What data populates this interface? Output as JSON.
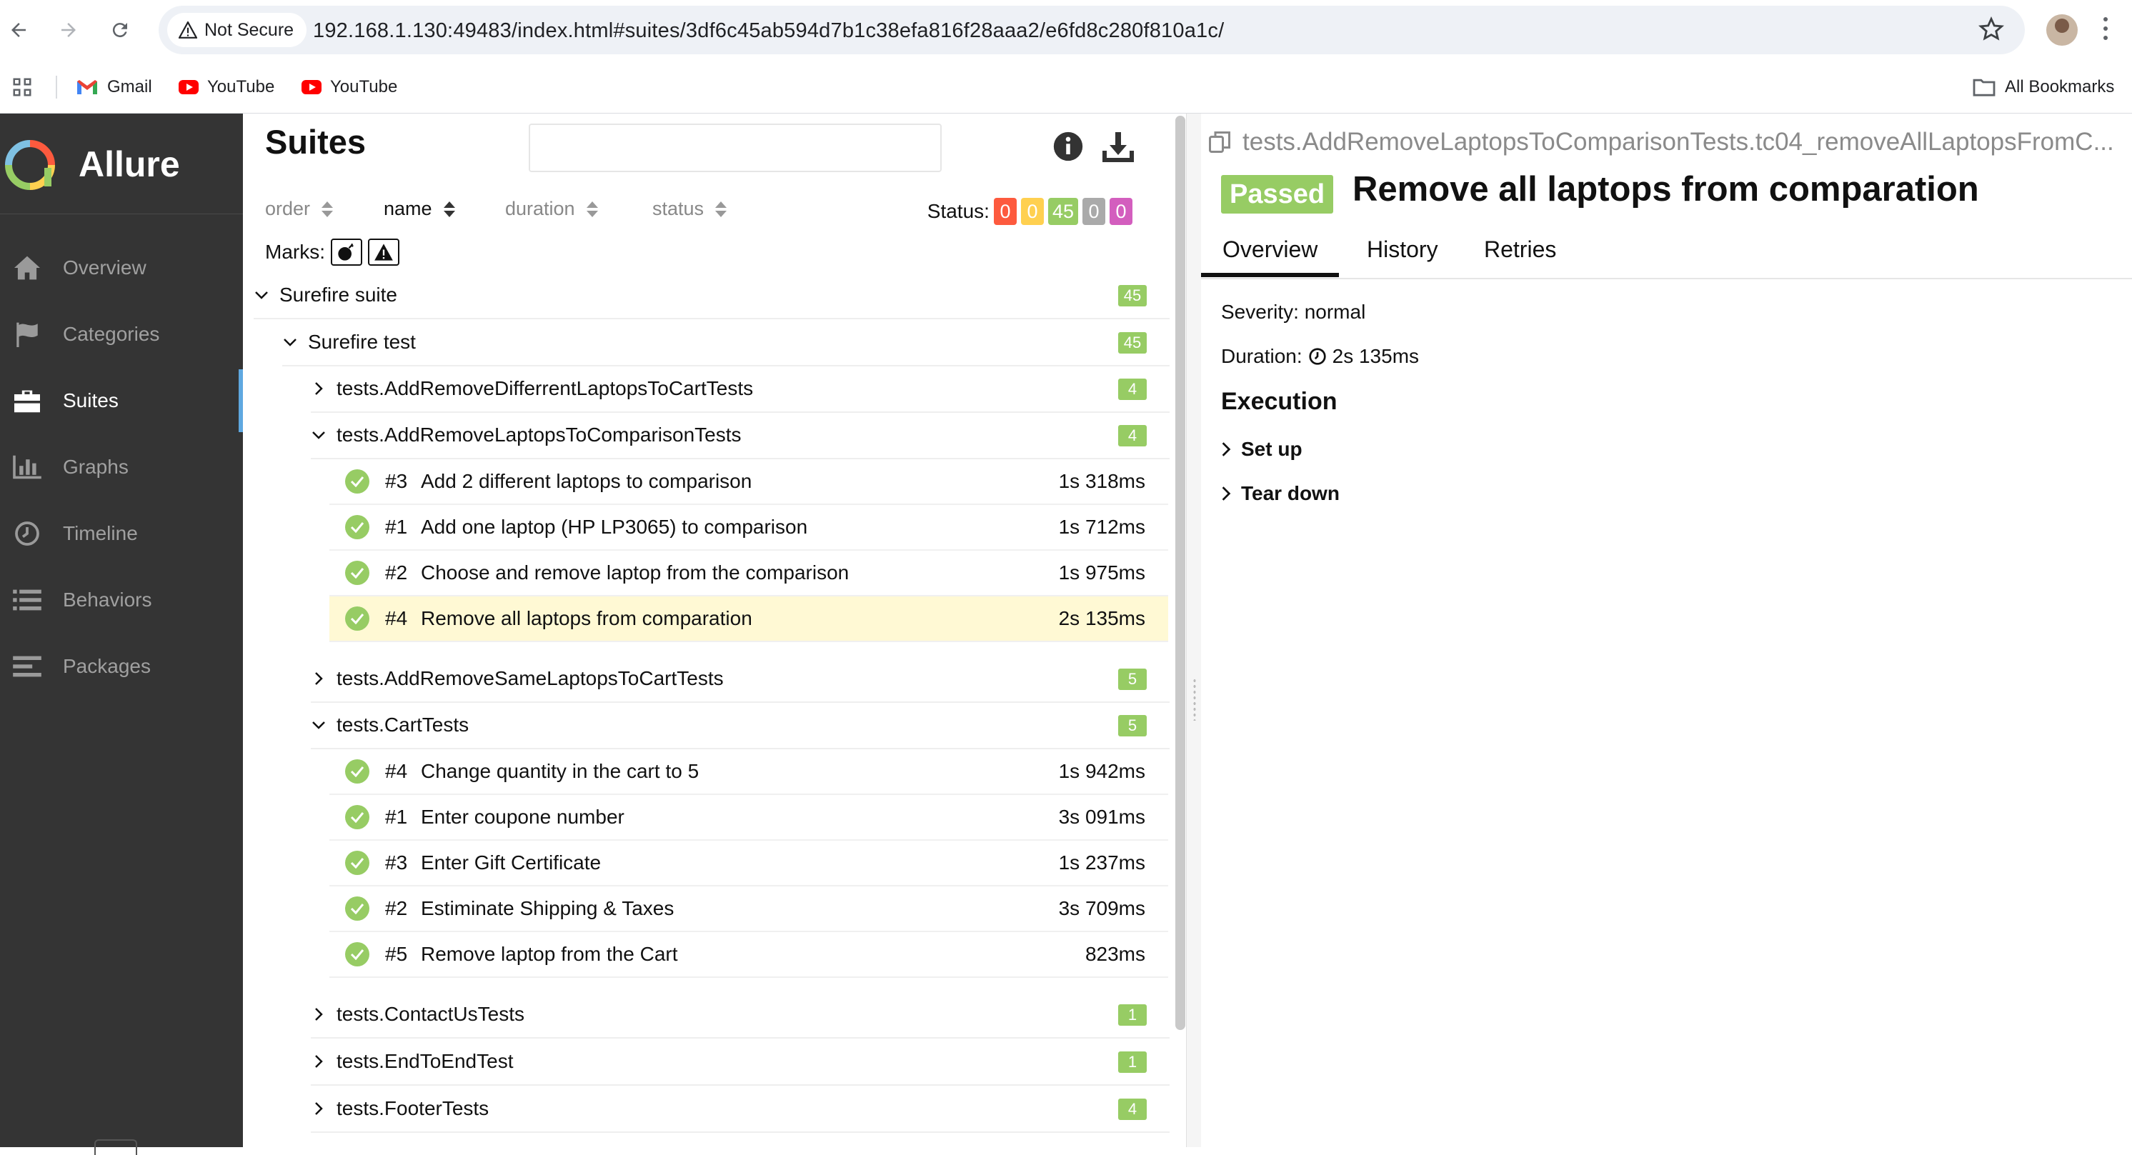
{
  "browser": {
    "security_label": "Not Secure",
    "url": "192.168.1.130:49483/index.html#suites/3df6c45ab594d7b1c38efa816f28aaa2/e6fd8c280f810a1c/",
    "bookmarks": [
      "Gmail",
      "YouTube",
      "YouTube"
    ],
    "all_bookmarks": "All Bookmarks"
  },
  "sidebar": {
    "brand": "Allure",
    "items": [
      {
        "label": "Overview",
        "icon": "home-icon"
      },
      {
        "label": "Categories",
        "icon": "flag-icon"
      },
      {
        "label": "Suites",
        "icon": "briefcase-icon"
      },
      {
        "label": "Graphs",
        "icon": "bar-chart-icon"
      },
      {
        "label": "Timeline",
        "icon": "clock-icon"
      },
      {
        "label": "Behaviors",
        "icon": "list-icon"
      },
      {
        "label": "Packages",
        "icon": "align-left-icon"
      }
    ]
  },
  "suites": {
    "title": "Suites",
    "search_value": "",
    "sort": [
      "order",
      "name",
      "duration",
      "status"
    ],
    "status_label": "Status:",
    "status_counts": [
      {
        "value": "0",
        "color": "#fd5a3e"
      },
      {
        "value": "0",
        "color": "#ffd050"
      },
      {
        "value": "45",
        "color": "#97cc64"
      },
      {
        "value": "0",
        "color": "#aaaaaa"
      },
      {
        "value": "0",
        "color": "#d35ebe"
      }
    ],
    "marks_label": "Marks:",
    "tree": {
      "root": {
        "name": "Surefire suite",
        "count": "45"
      },
      "test": {
        "name": "Surefire test",
        "count": "45"
      },
      "classes": [
        {
          "name": "tests.AddRemoveDifferrentLaptopsToCartTests",
          "count": "4"
        },
        {
          "name": "tests.AddRemoveLaptopsToComparisonTests",
          "count": "4"
        },
        {
          "name": "tests.AddRemoveSameLaptopsToCartTests",
          "count": "5"
        },
        {
          "name": "tests.CartTests",
          "count": "5"
        },
        {
          "name": "tests.ContactUsTests",
          "count": "1"
        },
        {
          "name": "tests.EndToEndTest",
          "count": "1"
        },
        {
          "name": "tests.FooterTests",
          "count": "4"
        }
      ],
      "comparison_tests": [
        {
          "num": "#3",
          "name": "Add 2 different laptops to comparison",
          "duration": "1s 318ms"
        },
        {
          "num": "#1",
          "name": "Add one laptop (HP LP3065) to comparison",
          "duration": "1s 712ms"
        },
        {
          "num": "#2",
          "name": "Choose and remove laptop from the comparison",
          "duration": "1s 975ms"
        },
        {
          "num": "#4",
          "name": "Remove all laptops from comparation",
          "duration": "2s 135ms"
        }
      ],
      "cart_tests": [
        {
          "num": "#4",
          "name": "Change quantity in the cart to 5",
          "duration": "1s 942ms"
        },
        {
          "num": "#1",
          "name": "Enter coupone number",
          "duration": "3s 091ms"
        },
        {
          "num": "#3",
          "name": "Enter Gift Certificate",
          "duration": "1s 237ms"
        },
        {
          "num": "#2",
          "name": "Estiminate Shipping & Taxes",
          "duration": "3s 709ms"
        },
        {
          "num": "#5",
          "name": "Remove laptop from the Cart",
          "duration": "823ms"
        }
      ]
    }
  },
  "detail": {
    "breadcrumb": "tests.AddRemoveLaptopsToComparisonTests.tc04_removeAllLaptopsFromC...",
    "status": "Passed",
    "title": "Remove all laptops from comparation",
    "tabs": [
      "Overview",
      "History",
      "Retries"
    ],
    "severity": "Severity: normal",
    "duration_label": "Duration:",
    "duration_value": "2s 135ms",
    "execution": "Execution",
    "stages": [
      "Set up",
      "Tear down"
    ]
  }
}
